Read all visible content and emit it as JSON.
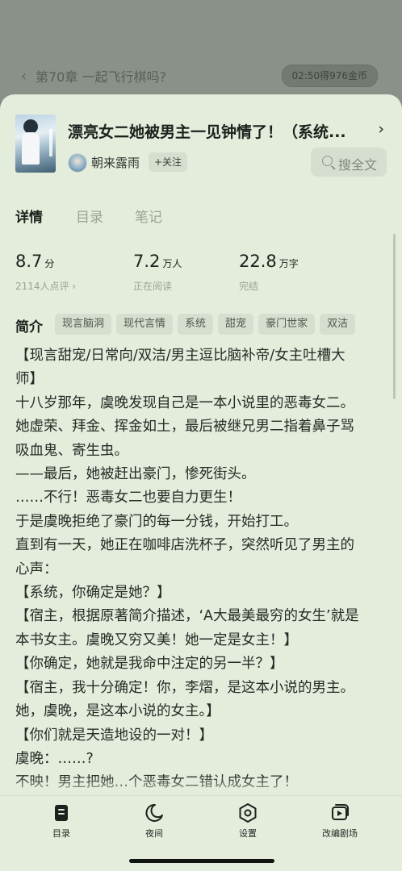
{
  "background": {
    "chapter_title": "第70章 一起飞行棋吗?",
    "reward_text": "02:50得976金币"
  },
  "book": {
    "title": "漂亮女二她被男主一见钟情了！（系统...",
    "author": "朝来露雨",
    "follow_label": "+关注",
    "search_label": "搜全文"
  },
  "tabs": [
    {
      "label": "详情",
      "active": true
    },
    {
      "label": "目录",
      "active": false
    },
    {
      "label": "笔记",
      "active": false
    }
  ],
  "stats": {
    "rating": {
      "value": "8.7",
      "unit": "分",
      "sub": "2114人点评 ›"
    },
    "readers": {
      "value": "7.2",
      "unit": "万人",
      "sub": "正在阅读"
    },
    "words": {
      "value": "22.8",
      "unit": "万字",
      "sub": "完结"
    }
  },
  "intro": {
    "label": "简介",
    "tags": [
      "现言脑洞",
      "现代言情",
      "系统",
      "甜宠",
      "豪门世家",
      "双洁"
    ],
    "lines": [
      "【现言甜宠/日常向/双洁/男主逗比脑补帝/女主吐槽大",
      "师】",
      "十八岁那年，虞晚发现自己是一本小说里的恶毒女二。",
      "她虚荣、拜金、挥金如土，最后被继兄男二指着鼻子骂",
      "吸血鬼、寄生虫。",
      "——最后，她被赶出豪门，惨死街头。",
      "……不行！恶毒女二也要自力更生！",
      "于是虞晚拒绝了豪门的每一分钱，开始打工。",
      "直到有一天，她正在咖啡店洗杯子，突然听见了男主的",
      "心声：",
      "【系统，你确定是她？】",
      "【宿主，根据原著简介描述，‘A大最美最穷的女生’就是",
      "本书女主。虞晚又穷又美！她一定是女主！】",
      "【你确定，她就是我命中注定的另一半？】",
      "【宿主，我十分确定！你，李熠，是这本小说的男主。",
      "她，虞晚，是这本小说的女主。】",
      "【你们就是天造地设的一对！】",
      "虞晚：……?",
      "不映！男主把她…个恶毒女二错认成女主了！"
    ]
  },
  "bottom_nav": [
    {
      "label": "目录",
      "icon": "catalog-icon"
    },
    {
      "label": "夜间",
      "icon": "moon-icon"
    },
    {
      "label": "设置",
      "icon": "settings-icon"
    },
    {
      "label": "改编剧场",
      "icon": "play-icon"
    }
  ],
  "colors": {
    "sheet_background": "#e4ecdc",
    "tag_background": "#d6dfcf",
    "overlay_background": "#8a9189",
    "text_primary": "#1d211c",
    "text_secondary": "#9aa396"
  }
}
